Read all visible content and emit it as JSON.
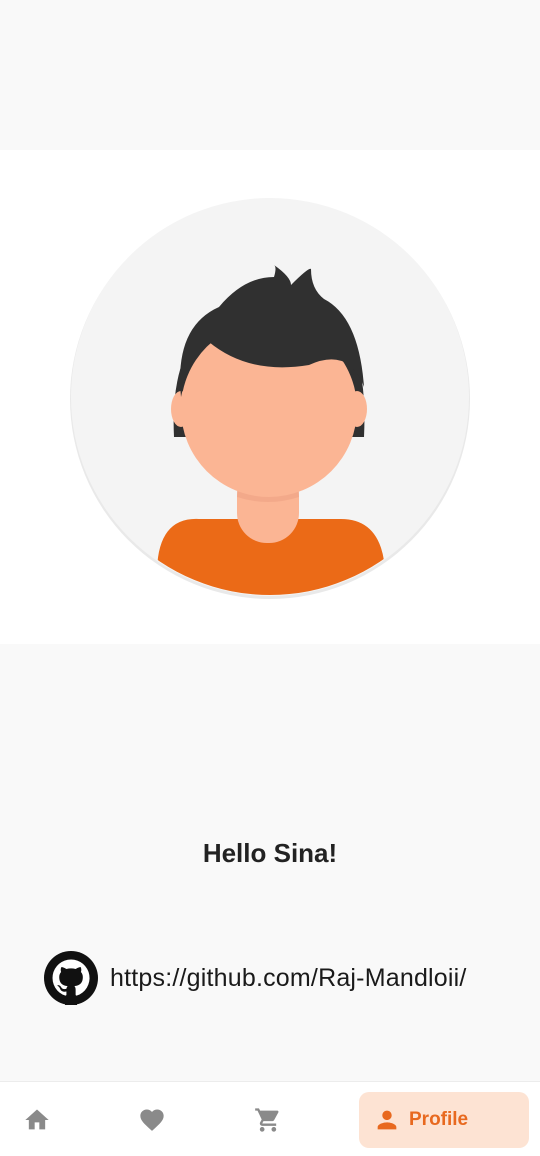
{
  "profile": {
    "greeting": "Hello Sina!",
    "github_url": "https://github.com/Raj-Mandloii/"
  },
  "bottom_nav": {
    "items": [
      {
        "icon": "home-icon",
        "label": "",
        "active": false
      },
      {
        "icon": "heart-icon",
        "label": "",
        "active": false
      },
      {
        "icon": "cart-icon",
        "label": "",
        "active": false
      },
      {
        "icon": "person-icon",
        "label": "Profile",
        "active": true
      }
    ]
  },
  "colors": {
    "accent": "#e8691f",
    "active_pill": "#fde3d3",
    "inactive_icon": "#8a8a8a",
    "background": "#f9f9f9"
  }
}
